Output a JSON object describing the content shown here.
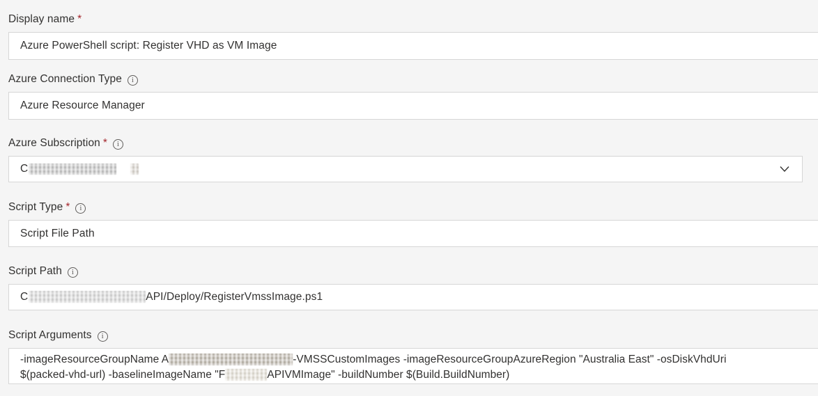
{
  "theme": {
    "page_background": "#f5f5f5",
    "field_background": "#ffffff",
    "field_border": "#d6d6d6",
    "text_color": "#323130",
    "required_star_color": "#a4262c",
    "info_icon_color": "#605e5c"
  },
  "form": {
    "fields": [
      {
        "name": "display-name",
        "label": "Display name",
        "required": true,
        "has_info": false,
        "control": "text",
        "value": "Azure PowerShell script: Register VHD as VM Image"
      },
      {
        "name": "azure-connection-type",
        "label": "Azure Connection Type",
        "required": false,
        "has_info": true,
        "control": "text",
        "value": "Azure Resource Manager"
      },
      {
        "name": "azure-subscription",
        "label": "Azure Subscription",
        "required": true,
        "has_info": true,
        "control": "combobox",
        "value_prefix": "C",
        "value_redacted": true,
        "chevron_icon": "chevron-down-icon"
      },
      {
        "name": "script-type",
        "label": "Script Type",
        "required": true,
        "has_info": true,
        "control": "text",
        "value": "Script File Path"
      },
      {
        "name": "script-path",
        "label": "Script Path",
        "required": false,
        "has_info": true,
        "control": "text",
        "value_prefix": "C",
        "value_redacted": true,
        "value_suffix": "API/Deploy/RegisterVmssImage.ps1"
      },
      {
        "name": "script-arguments",
        "label": "Script Arguments",
        "required": false,
        "has_info": true,
        "control": "textarea",
        "line1_prefix": "-imageResourceGroupName A",
        "line1_redacted": true,
        "line1_suffix": "-VMSSCustomImages -imageResourceGroupAzureRegion \"Australia East\" -osDiskVhdUri",
        "line2_prefix": "$(packed-vhd-url) -baselineImageName \"F",
        "line2_redacted": true,
        "line2_suffix": "APIVMImage\" -buildNumber $(Build.BuildNumber)"
      }
    ],
    "icons": {
      "info": "info-icon",
      "chevron_down": "chevron-down-icon"
    }
  }
}
